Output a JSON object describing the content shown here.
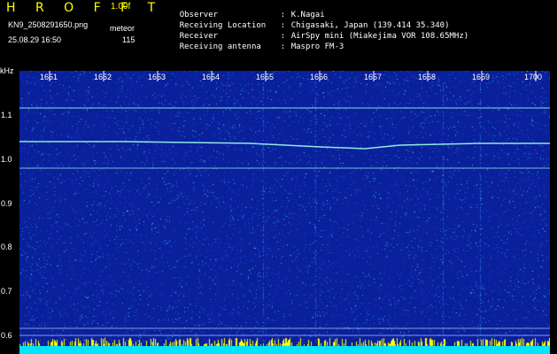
{
  "header": {
    "title": "H R O F F T",
    "version": "1.00f",
    "file_name": "KN9_2508291650.png",
    "meteor_label": "meteor",
    "datetime": "25.08.29 16:50",
    "meteor_count": "115"
  },
  "station": [
    {
      "label": "Observer",
      "value": "K.Nagai"
    },
    {
      "label": "Receiving Location",
      "value": "Chigasaki, Japan (139.414 35.340)"
    },
    {
      "label": "Receiver",
      "value": "AirSpy mini (Miakejima VOR 108.65MHz)"
    },
    {
      "label": "Receiving antenna",
      "value": "Maspro FM-3"
    }
  ],
  "colon": ":",
  "colors": {
    "title": "#ffff00",
    "background": "#000000",
    "spectrogram_base": "#0a1f9a",
    "signal": "#a0ffe8",
    "bottom_strip": "#00e5ff",
    "bottom_marks": "#ffff00"
  },
  "y_axis": {
    "unit": "kHz",
    "ticks": [
      "1.1",
      "1.0",
      "0.9",
      "0.8",
      "0.7",
      "0.6"
    ]
  },
  "x_axis": {
    "ticks": [
      "1651",
      "1652",
      "1653",
      "1654",
      "1655",
      "1656",
      "1657",
      "1658",
      "1659",
      "1700"
    ]
  }
}
